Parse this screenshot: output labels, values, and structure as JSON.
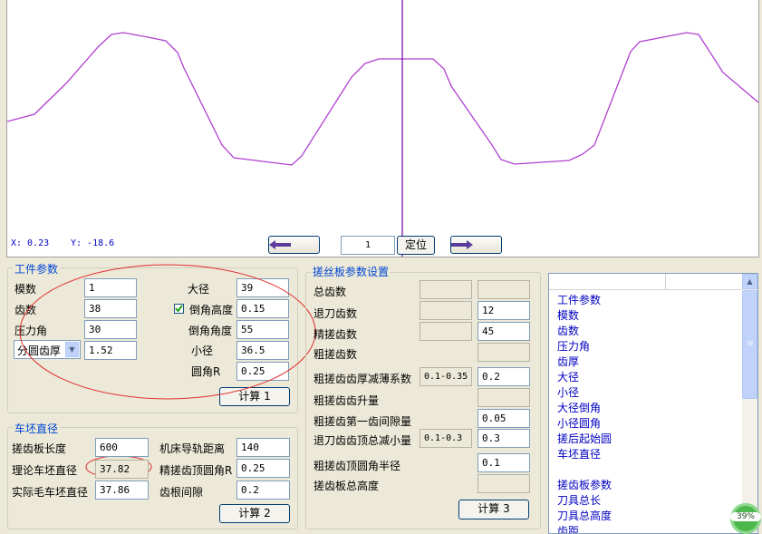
{
  "plot": {
    "x_readout": "X: 0.23",
    "y_readout": "Y: -18.6",
    "nav_left_label": "←",
    "position_value": "1",
    "locate_button": "定位",
    "nav_right_label": "→",
    "curve_color": "#b040d0",
    "cursor_color": "#7000a0"
  },
  "workpiece": {
    "title": "工件参数",
    "module_label": "模数",
    "module_value": "1",
    "teeth_label": "齿数",
    "teeth_value": "38",
    "pressure_angle_label": "压力角",
    "pressure_angle_value": "30",
    "tooth_thickness_select": "分圆齿厚",
    "tooth_thickness_value": "1.52",
    "major_diameter_label": "大径",
    "major_diameter_value": "39",
    "chamfer_height_checked": true,
    "chamfer_height_label": "倒角高度",
    "chamfer_height_value": "0.15",
    "chamfer_angle_label": "倒角角度",
    "chamfer_angle_value": "55",
    "minor_diameter_label": "小径",
    "minor_diameter_value": "36.5",
    "fillet_label": "圆角R",
    "fillet_value": "0.25",
    "calc_button": "计算 1"
  },
  "blank": {
    "title": "车坯直径",
    "plate_length_label": "搓齿板长度",
    "plate_length_value": "600",
    "rail_distance_label": "机床导轨距离",
    "rail_distance_value": "140",
    "theory_diameter_label": "理论车坯直径",
    "theory_diameter_value": "37.82",
    "finish_fillet_label": "精搓齿顶圆角R",
    "finish_fillet_value": "0.25",
    "actual_diameter_label": "实际毛车坯直径",
    "actual_diameter_value": "37.86",
    "root_clearance_label": "齿根间隙",
    "root_clearance_value": "0.2",
    "calc_button": "计算 2"
  },
  "plate": {
    "title": "搓丝板参数设置",
    "total_teeth_label": "总齿数",
    "retract_teeth_label": "退刀齿数",
    "retract_teeth_value": "12",
    "finish_teeth_label": "精搓齿数",
    "finish_teeth_value": "45",
    "rough_teeth_label": "粗搓齿数",
    "rough_thin_label": "粗搓齿齿厚减薄系数",
    "rough_thin_range": "0.1-0.35",
    "rough_thin_value": "0.2",
    "rough_rise_label": "粗搓齿齿升量",
    "rough_first_gap_label": "粗搓齿第一齿间隙量",
    "rough_first_gap_value": "0.05",
    "retract_reduce_label": "退刀齿齿顶总减小量",
    "retract_reduce_range": "0.1-0.3",
    "retract_reduce_value": "0.3",
    "rough_fillet_label": "粗搓齿顶圆角半径",
    "rough_fillet_value": "0.1",
    "plate_height_label": "搓齿板总高度",
    "calc_button": "计算 3"
  },
  "list": {
    "items": [
      "工件参数",
      "模数",
      "齿数",
      "压力角",
      "齿厚",
      "大径",
      "小径",
      "大径倒角",
      "小径圆角",
      "搓后起始圆",
      "车坯直径",
      "",
      "搓齿板参数",
      "刀具总长",
      "刀具总高度",
      "齿距"
    ]
  },
  "badge": {
    "value": "39%"
  }
}
